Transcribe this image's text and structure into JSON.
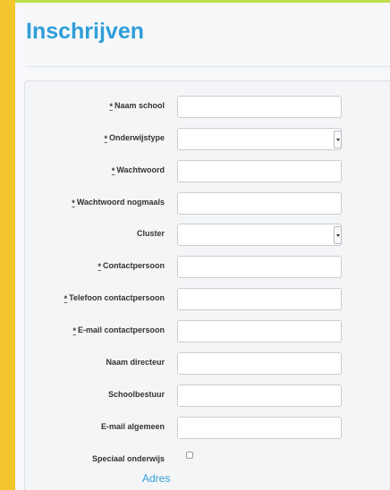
{
  "page": {
    "title": "Inschrijven"
  },
  "form": {
    "required_marker": "*",
    "fields": [
      {
        "label": "Naam school",
        "required": true,
        "type": "text",
        "value": ""
      },
      {
        "label": "Onderwijstype",
        "required": true,
        "type": "select",
        "value": ""
      },
      {
        "label": "Wachtwoord",
        "required": true,
        "type": "password",
        "value": ""
      },
      {
        "label": "Wachtwoord nogmaals",
        "required": true,
        "type": "password",
        "value": ""
      },
      {
        "label": "Cluster",
        "required": false,
        "type": "select",
        "value": ""
      },
      {
        "label": "Contactpersoon",
        "required": true,
        "type": "text",
        "value": ""
      },
      {
        "label": "Telefoon contactpersoon",
        "required": true,
        "type": "text",
        "value": ""
      },
      {
        "label": "E-mail contactpersoon",
        "required": true,
        "type": "text",
        "value": ""
      },
      {
        "label": "Naam directeur",
        "required": false,
        "type": "text",
        "value": ""
      },
      {
        "label": "Schoolbestuur",
        "required": false,
        "type": "text",
        "value": ""
      },
      {
        "label": "E-mail algemeen",
        "required": false,
        "type": "text",
        "value": ""
      }
    ],
    "checkbox": {
      "label": "Speciaal onderwijs",
      "checked": false
    },
    "section_link": "Adres"
  },
  "colors": {
    "background": "#f2c62c",
    "accent": "#2f9ed8",
    "top_line": "#bde04a"
  }
}
